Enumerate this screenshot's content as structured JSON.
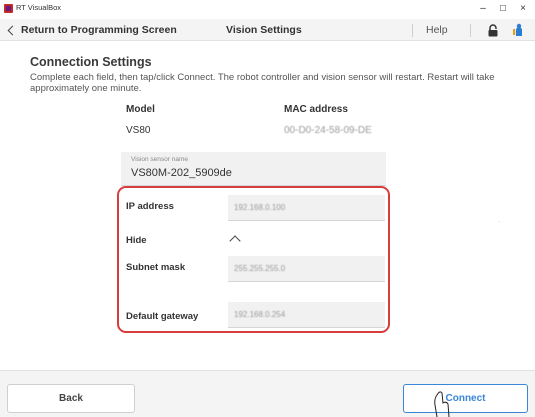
{
  "window": {
    "app_name": "RT VisualBox",
    "minimize": "–",
    "maximize": "□",
    "close": "×"
  },
  "nav": {
    "back_label": "Return to Programming Screen",
    "title": "Vision Settings",
    "help_label": "Help"
  },
  "section": {
    "title": "Connection Settings",
    "description": "Complete each field, then tap/click Connect. The robot controller and vision sensor will restart. Restart will take approximately one minute."
  },
  "device": {
    "model_header": "Model",
    "model_value": "VS80",
    "mac_header": "MAC address",
    "mac_value": "00-D0-24-58-09-DE"
  },
  "sensor_name": {
    "label": "Vision sensor name",
    "value": "VS80M-202_5909de"
  },
  "network": {
    "ip_label": "IP address",
    "ip_value": "192.168.0.100",
    "hide_label": "Hide",
    "subnet_label": "Subnet mask",
    "subnet_value": "255.255.255.0",
    "gateway_label": "Default gateway",
    "gateway_value": "192.168.0.254"
  },
  "footer": {
    "back_label": "Back",
    "connect_label": "Connect"
  },
  "colors": {
    "highlight": "#d93c3c",
    "accent": "#3a86d6",
    "app_icon": "#c02a2a"
  },
  "icons": {
    "back": "chevron-left-icon",
    "lock": "lock-icon",
    "person": "person-icon",
    "collapse": "chevron-up-icon",
    "cursor": "hand-cursor-icon"
  }
}
